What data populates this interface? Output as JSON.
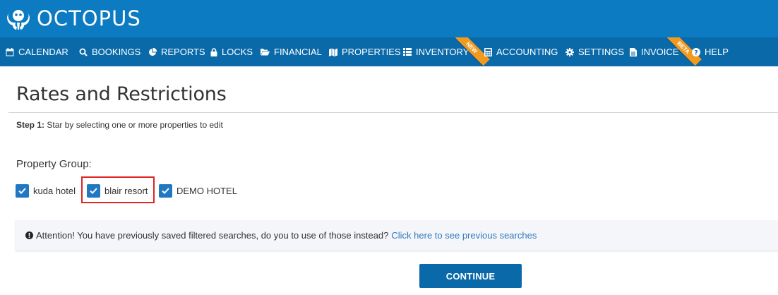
{
  "brand": {
    "name": "OCTOPUS"
  },
  "nav": {
    "items": [
      {
        "label": "CALENDAR",
        "icon": "calendar-icon"
      },
      {
        "label": "BOOKINGS",
        "icon": "search-icon"
      },
      {
        "label": "REPORTS",
        "icon": "pie-chart-icon"
      },
      {
        "label": "LOCKS",
        "icon": "lock-icon"
      },
      {
        "label": "FINANCIAL",
        "icon": "folder-open-icon"
      },
      {
        "label": "PROPERTIES",
        "icon": "map-icon"
      },
      {
        "label": "INVENTORY",
        "icon": "list-icon",
        "ribbon": "NEW"
      },
      {
        "label": "ACCOUNTING",
        "icon": "calculator-icon"
      },
      {
        "label": "SETTINGS",
        "icon": "gear-icon"
      },
      {
        "label": "INVOICE",
        "icon": "file-icon",
        "ribbon": "BETA"
      },
      {
        "label": "HELP",
        "icon": "question-circle-icon"
      }
    ]
  },
  "page": {
    "title": "Rates and Restrictions",
    "step_label": "Step 1:",
    "step_text": "Star by selecting one or more properties to edit",
    "group_label": "Property Group:",
    "properties": [
      {
        "label": "kuda hotel",
        "checked": true
      },
      {
        "label": "blair resort",
        "checked": true,
        "highlighted": true
      },
      {
        "label": "DEMO HOTEL",
        "checked": true
      }
    ],
    "alert": {
      "text": "Attention! You have previously saved filtered searches, do you to use of those instead?",
      "link": "Click here to see previous searches"
    },
    "continue_label": "CONTINUE"
  },
  "colors": {
    "topbar": "#0c7bc2",
    "navbar": "#0a6aa9",
    "ribbon": "#f29a1d",
    "checkbox": "#1f78c1",
    "highlight": "#e02323",
    "link": "#3279bd"
  }
}
